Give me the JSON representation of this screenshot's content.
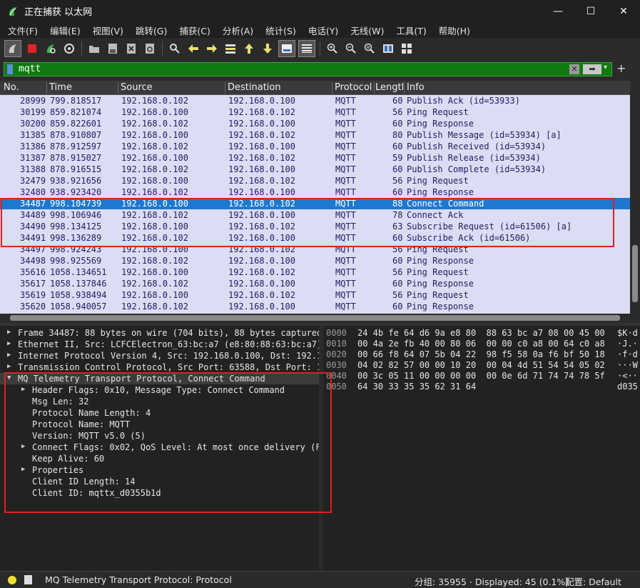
{
  "window": {
    "title": "正在捕获 以太网",
    "min_icon": "minimize-icon",
    "max_icon": "maximize-icon",
    "close_icon": "close-icon",
    "min_glyph": "—",
    "max_glyph": "☐",
    "close_glyph": "✕"
  },
  "menu": [
    "文件(F)",
    "编辑(E)",
    "视图(V)",
    "跳转(G)",
    "捕获(C)",
    "分析(A)",
    "统计(S)",
    "电话(Y)",
    "无线(W)",
    "工具(T)",
    "帮助(H)"
  ],
  "filter": {
    "value": "mqtt",
    "clear_glyph": "✕",
    "apply_glyph": "➡",
    "dropdown_glyph": "▾",
    "add_glyph": "+"
  },
  "packet_list": {
    "columns": [
      "No.",
      "Time",
      "Source",
      "Destination",
      "Protocol",
      "Length",
      "Info"
    ],
    "rows": [
      {
        "no": "28999",
        "time": "799.818517",
        "src": "192.168.0.102",
        "dst": "192.168.0.100",
        "proto": "MQTT",
        "len": "60",
        "info": "Publish Ack (id=53933)"
      },
      {
        "no": "30199",
        "time": "859.821074",
        "src": "192.168.0.100",
        "dst": "192.168.0.102",
        "proto": "MQTT",
        "len": "56",
        "info": "Ping Request"
      },
      {
        "no": "30200",
        "time": "859.822601",
        "src": "192.168.0.102",
        "dst": "192.168.0.100",
        "proto": "MQTT",
        "len": "60",
        "info": "Ping Response"
      },
      {
        "no": "31385",
        "time": "878.910807",
        "src": "192.168.0.100",
        "dst": "192.168.0.102",
        "proto": "MQTT",
        "len": "80",
        "info": "Publish Message (id=53934) [a]"
      },
      {
        "no": "31386",
        "time": "878.912597",
        "src": "192.168.0.102",
        "dst": "192.168.0.100",
        "proto": "MQTT",
        "len": "60",
        "info": "Publish Received (id=53934)"
      },
      {
        "no": "31387",
        "time": "878.915027",
        "src": "192.168.0.100",
        "dst": "192.168.0.102",
        "proto": "MQTT",
        "len": "59",
        "info": "Publish Release (id=53934)"
      },
      {
        "no": "31388",
        "time": "878.916515",
        "src": "192.168.0.102",
        "dst": "192.168.0.100",
        "proto": "MQTT",
        "len": "60",
        "info": "Publish Complete (id=53934)"
      },
      {
        "no": "32479",
        "time": "938.921656",
        "src": "192.168.0.100",
        "dst": "192.168.0.102",
        "proto": "MQTT",
        "len": "56",
        "info": "Ping Request"
      },
      {
        "no": "32480",
        "time": "938.923420",
        "src": "192.168.0.102",
        "dst": "192.168.0.100",
        "proto": "MQTT",
        "len": "60",
        "info": "Ping Response"
      },
      {
        "no": "34487",
        "time": "998.104739",
        "src": "192.168.0.100",
        "dst": "192.168.0.102",
        "proto": "MQTT",
        "len": "88",
        "info": "Connect Command",
        "selected": true
      },
      {
        "no": "34489",
        "time": "998.106946",
        "src": "192.168.0.102",
        "dst": "192.168.0.100",
        "proto": "MQTT",
        "len": "78",
        "info": "Connect Ack"
      },
      {
        "no": "34490",
        "time": "998.134125",
        "src": "192.168.0.100",
        "dst": "192.168.0.102",
        "proto": "MQTT",
        "len": "63",
        "info": "Subscribe Request (id=61506) [a]"
      },
      {
        "no": "34491",
        "time": "998.136289",
        "src": "192.168.0.102",
        "dst": "192.168.0.100",
        "proto": "MQTT",
        "len": "60",
        "info": "Subscribe Ack (id=61506)"
      },
      {
        "no": "34497",
        "time": "998.924243",
        "src": "192.168.0.100",
        "dst": "192.168.0.102",
        "proto": "MQTT",
        "len": "56",
        "info": "Ping Request"
      },
      {
        "no": "34498",
        "time": "998.925569",
        "src": "192.168.0.102",
        "dst": "192.168.0.100",
        "proto": "MQTT",
        "len": "60",
        "info": "Ping Response"
      },
      {
        "no": "35616",
        "time": "1058.134651",
        "src": "192.168.0.100",
        "dst": "192.168.0.102",
        "proto": "MQTT",
        "len": "56",
        "info": "Ping Request"
      },
      {
        "no": "35617",
        "time": "1058.137846",
        "src": "192.168.0.102",
        "dst": "192.168.0.100",
        "proto": "MQTT",
        "len": "60",
        "info": "Ping Response"
      },
      {
        "no": "35619",
        "time": "1058.938494",
        "src": "192.168.0.100",
        "dst": "192.168.0.102",
        "proto": "MQTT",
        "len": "56",
        "info": "Ping Request"
      },
      {
        "no": "35620",
        "time": "1058.940057",
        "src": "192.168.0.102",
        "dst": "192.168.0.100",
        "proto": "MQTT",
        "len": "60",
        "info": "Ping Response"
      }
    ]
  },
  "details": [
    {
      "arrow": "▶",
      "indent": 0,
      "text": "Frame 34487: 88 bytes on wire (704 bits), 88 bytes captured"
    },
    {
      "arrow": "▶",
      "indent": 0,
      "text": "Ethernet II, Src: LCFCElectron_63:bc:a7 (e8:80:88:63:bc:a7)"
    },
    {
      "arrow": "▶",
      "indent": 0,
      "text": "Internet Protocol Version 4, Src: 192.168.0.100, Dst: 192.1"
    },
    {
      "arrow": "▶",
      "indent": 0,
      "text": "Transmission Control Protocol, Src Port: 63588, Dst Port: 1"
    },
    {
      "arrow": "▼",
      "indent": 0,
      "text": "MQ Telemetry Transport Protocol, Connect Command"
    },
    {
      "arrow": "▶",
      "indent": 1,
      "text": "Header Flags: 0x10, Message Type: Connect Command"
    },
    {
      "arrow": "",
      "indent": 1,
      "text": "Msg Len: 32"
    },
    {
      "arrow": "",
      "indent": 1,
      "text": "Protocol Name Length: 4"
    },
    {
      "arrow": "",
      "indent": 1,
      "text": "Protocol Name: MQTT"
    },
    {
      "arrow": "",
      "indent": 1,
      "text": "Version: MQTT v5.0 (5)"
    },
    {
      "arrow": "▶",
      "indent": 1,
      "text": "Connect Flags: 0x02, QoS Level: At most once delivery (F"
    },
    {
      "arrow": "",
      "indent": 1,
      "text": "Keep Alive: 60"
    },
    {
      "arrow": "▶",
      "indent": 1,
      "text": "Properties"
    },
    {
      "arrow": "",
      "indent": 1,
      "text": "Client ID Length: 14"
    },
    {
      "arrow": "",
      "indent": 1,
      "text": "Client ID: mqttx_d0355b1d"
    }
  ],
  "bytes": [
    {
      "off": "0000",
      "hex": "24 4b fe 64 d6 9a e8 80  88 63 bc a7 08 00 45 00",
      "asc": "$K·d"
    },
    {
      "off": "0010",
      "hex": "00 4a 2e fb 40 00 80 06  00 00 c0 a8 00 64 c0 a8",
      "asc": "·J.·"
    },
    {
      "off": "0020",
      "hex": "00 66 f8 64 07 5b 04 22  98 f5 58 0a f6 bf 50 18",
      "asc": "·f·d"
    },
    {
      "off": "0030",
      "hex": "04 02 82 57 00 00 10 20  00 04 4d 51 54 54 05 02",
      "asc": "···W"
    },
    {
      "off": "0040",
      "hex": "00 3c 05 11 00 00 00 00  00 0e 6d 71 74 74 78 5f",
      "asc": "·<··"
    },
    {
      "off": "0050",
      "hex": "64 30 33 35 35 62 31 64",
      "asc": "d035"
    }
  ],
  "status": {
    "message": "MQ Telemetry Transport Protocol: Protocol",
    "stats": "分组: 35955 · Displayed: 45 (0.1%)",
    "profile": "配置: Default"
  }
}
